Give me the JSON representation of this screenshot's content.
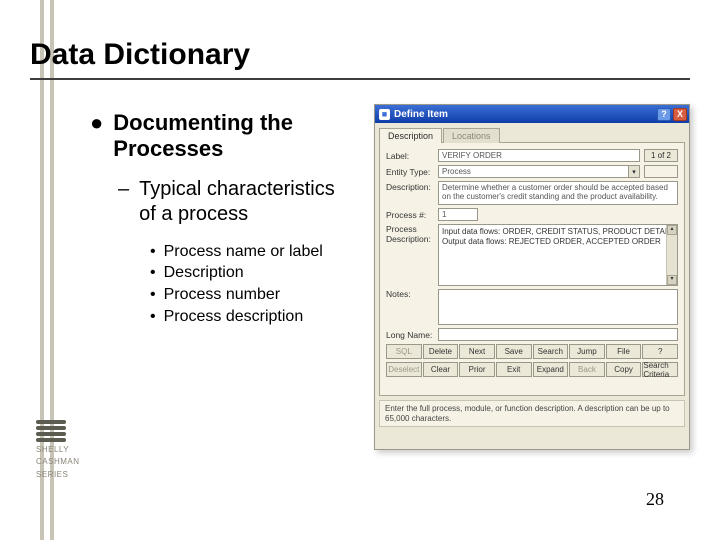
{
  "slide": {
    "title": "Data Dictionary",
    "page_number": "28",
    "bullet1": "Documenting the Processes",
    "bullet2": "Typical characteristics of a process",
    "bullets3": [
      "Process name or label",
      "Description",
      "Process number",
      "Process description"
    ],
    "logo_lines": [
      "SHELLY",
      "CASHMAN",
      "SERIES"
    ]
  },
  "win": {
    "title": "Define Item",
    "help_icon": "?",
    "close_icon": "X",
    "tabs": {
      "active": "Description",
      "inactive": "Locations"
    },
    "labels": {
      "label": "Label:",
      "entity": "Entity Type:",
      "description": "Description:",
      "process_no": "Process #:",
      "process_desc": "Process Description:",
      "notes": "Notes:",
      "long_name": "Long Name:"
    },
    "values": {
      "label": "VERIFY ORDER",
      "badge": "1 of 2",
      "entity": "Process",
      "description": "Determine whether a customer order should be accepted based on the customer's credit standing and the product availability.",
      "process_no": "1",
      "process_desc_line1": "Input data flows:      ORDER, CREDIT STATUS, PRODUCT DETAIL",
      "process_desc_line2": "Output data flows:     REJECTED ORDER, ACCEPTED ORDER"
    },
    "buttons_row1": [
      "SQL",
      "Delete",
      "Next",
      "Save",
      "Search",
      "Jump",
      "File",
      "?"
    ],
    "buttons_row2": [
      "Deselect",
      "Clear",
      "Prior",
      "Exit",
      "Expand",
      "Back",
      "Copy",
      "Search Criteria"
    ],
    "disabled_buttons": [
      "SQL",
      "Deselect",
      "Back"
    ],
    "status": "Enter the full process, module, or function description. A description can be up to 65,000 characters."
  }
}
